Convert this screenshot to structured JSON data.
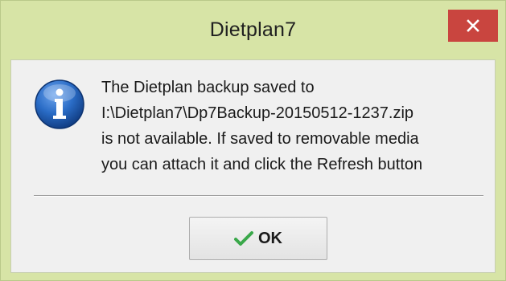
{
  "window": {
    "title": "Dietplan7",
    "close_symbol": "×"
  },
  "dialog": {
    "icon": "info-icon",
    "message_lines": [
      "The Dietplan backup saved to",
      "I:\\Dietplan7\\Dp7Backup-20150512-1237.zip",
      "is not available. If saved to removable media",
      "you can attach it and click the Refresh button"
    ]
  },
  "buttons": {
    "ok_label": "OK",
    "ok_icon": "checkmark-icon"
  },
  "colors": {
    "titlebar": "#d7e4a6",
    "close_button": "#c9453f",
    "content_bg": "#f0f0f0",
    "checkmark": "#3aa84a",
    "info_icon_blue": "#1f5fb8"
  }
}
